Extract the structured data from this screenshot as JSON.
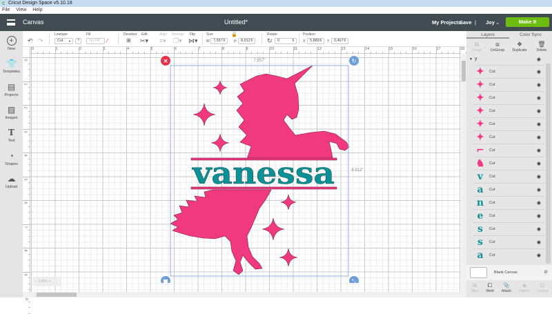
{
  "window": {
    "title": "Cricut Design Space  v5.10.18",
    "menu": [
      "File",
      "View",
      "Help"
    ]
  },
  "header": {
    "section": "Canvas",
    "document_title": "Untitled*",
    "my_projects": "My Projects",
    "save": "Save",
    "divider": "|",
    "user": "Joy",
    "make_it": "Make It"
  },
  "leftbar": [
    {
      "label": "New",
      "icon": "plus-circle-icon"
    },
    {
      "label": "Templates",
      "icon": "tshirt-icon"
    },
    {
      "label": "Projects",
      "icon": "notebook-icon"
    },
    {
      "label": "Images",
      "icon": "image-icon"
    },
    {
      "label": "Text",
      "icon": "text-icon"
    },
    {
      "label": "Shapes",
      "icon": "shapes-icon"
    },
    {
      "label": "Upload",
      "icon": "cloud-upload-icon"
    }
  ],
  "toolbar": {
    "linetype_label": "Linetype",
    "linetype_value": "Cut",
    "help": "?",
    "fill_label": "Fill",
    "fill_value": "No Fill",
    "deselect": "Deselect",
    "edit": "Edit",
    "align": "Align",
    "arrange": "Arrange",
    "flip": "Flip",
    "size_label": "Size",
    "w_label": "W",
    "w_value": "7,557",
    "h_label": "H",
    "h_value": "8,912",
    "rotate_label": "Rotate",
    "rotate_value": "0",
    "position_label": "Position",
    "x_label": "X",
    "x_value": "5,889",
    "y_label": "Y",
    "y_value": "0,467"
  },
  "rulers": {
    "horizontal": [
      "0",
      "1",
      "2",
      "3",
      "4",
      "5",
      "6",
      "7",
      "8",
      "9",
      "10",
      "11",
      "12",
      "13",
      "14",
      "15",
      "16",
      "17",
      "18"
    ],
    "vertical": [
      "0",
      "1",
      "2",
      "3",
      "4",
      "5",
      "6",
      "7",
      "8",
      "9",
      "10"
    ]
  },
  "selection": {
    "width_label": "7.557\"",
    "height_label": "8.912\""
  },
  "design": {
    "text": "vanessa",
    "colors": {
      "pink": "#f0397f",
      "teal": "#0e9196"
    }
  },
  "zoom": {
    "minus": "−",
    "value": "100%",
    "plus": "+"
  },
  "panel": {
    "tabs": [
      "Layers",
      "Color Sync"
    ],
    "actions": [
      {
        "label": "Group",
        "enabled": false
      },
      {
        "label": "UnGroup",
        "enabled": true
      },
      {
        "label": "Duplicate",
        "enabled": true
      },
      {
        "label": "Delete",
        "enabled": true
      }
    ],
    "group_name": "y",
    "layers": [
      {
        "thumb": "star",
        "glyph": "✦",
        "name": "Cut",
        "color": "#f0397f"
      },
      {
        "thumb": "star",
        "glyph": "✦",
        "name": "Cut",
        "color": "#f0397f"
      },
      {
        "thumb": "star",
        "glyph": "✦",
        "name": "Cut",
        "color": "#f0397f"
      },
      {
        "thumb": "star",
        "glyph": "✦",
        "name": "Cut",
        "color": "#f0397f"
      },
      {
        "thumb": "star",
        "glyph": "✦",
        "name": "Cut",
        "color": "#f0397f"
      },
      {
        "thumb": "star",
        "glyph": "✦",
        "name": "Cut",
        "color": "#f0397f"
      },
      {
        "thumb": "unicorn-top",
        "glyph": "⌐",
        "name": "Cut",
        "color": "#f0397f"
      },
      {
        "thumb": "unicorn-bottom",
        "glyph": "♞",
        "name": "Cut",
        "color": "#f0397f"
      },
      {
        "thumb": "letter",
        "glyph": "v",
        "name": "Cut",
        "color": "#0e9196"
      },
      {
        "thumb": "letter",
        "glyph": "a",
        "name": "Cut",
        "color": "#0e9196"
      },
      {
        "thumb": "letter",
        "glyph": "n",
        "name": "Cut",
        "color": "#0e9196"
      },
      {
        "thumb": "letter",
        "glyph": "e",
        "name": "Cut",
        "color": "#0e9196"
      },
      {
        "thumb": "letter",
        "glyph": "s",
        "name": "Cut",
        "color": "#0e9196"
      },
      {
        "thumb": "letter",
        "glyph": "s",
        "name": "Cut",
        "color": "#0e9196"
      },
      {
        "thumb": "letter",
        "glyph": "a",
        "name": "Cut",
        "color": "#0e9196"
      }
    ],
    "blank_canvas": "Blank Canvas",
    "bottom_actions": [
      {
        "label": "Slice",
        "enabled": false
      },
      {
        "label": "Weld",
        "enabled": true
      },
      {
        "label": "Attach",
        "enabled": true
      },
      {
        "label": "Flatten",
        "enabled": false
      },
      {
        "label": "Contour",
        "enabled": false
      }
    ]
  },
  "colors": {
    "header": "#414b52",
    "make_it": "#6cbd0f",
    "selection": "#8fb0dd",
    "handle_blue": "#6f9fd8",
    "handle_red": "#e2334a"
  }
}
